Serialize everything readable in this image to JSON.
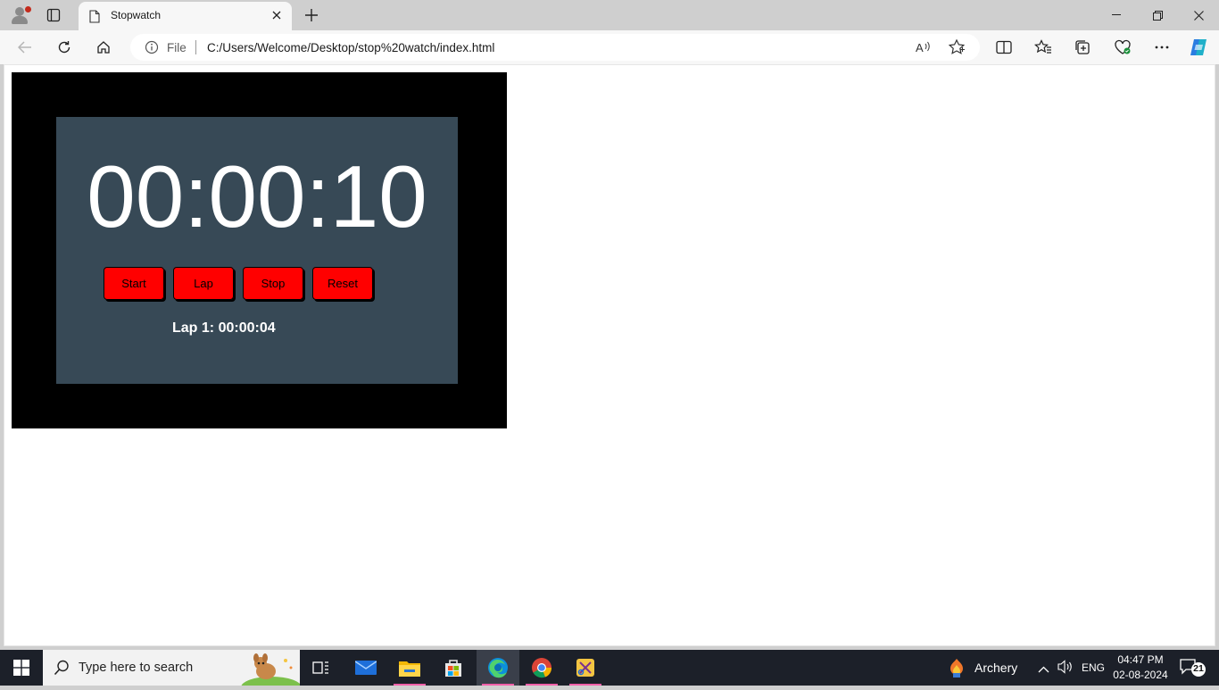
{
  "browser": {
    "tab_title": "Stopwatch",
    "address_scheme_label": "File",
    "address_url": "C:/Users/Welcome/Desktop/stop%20watch/index.html"
  },
  "stopwatch": {
    "time": "00:00:10",
    "buttons": {
      "start": "Start",
      "lap": "Lap",
      "stop": "Stop",
      "reset": "Reset"
    },
    "laps": [
      "Lap 1: 00:00:04"
    ],
    "colors": {
      "frame": "#000000",
      "panel": "#374956",
      "button": "#ff0000",
      "text": "#ffffff"
    }
  },
  "taskbar": {
    "search_placeholder": "Type here to search",
    "weather_label": "Archery",
    "language": "ENG",
    "time": "04:47 PM",
    "date": "02-08-2024",
    "notification_count": "21",
    "apps": [
      "task-view",
      "mail",
      "file-explorer",
      "microsoft-store",
      "edge",
      "chrome",
      "snipping-tool"
    ]
  }
}
